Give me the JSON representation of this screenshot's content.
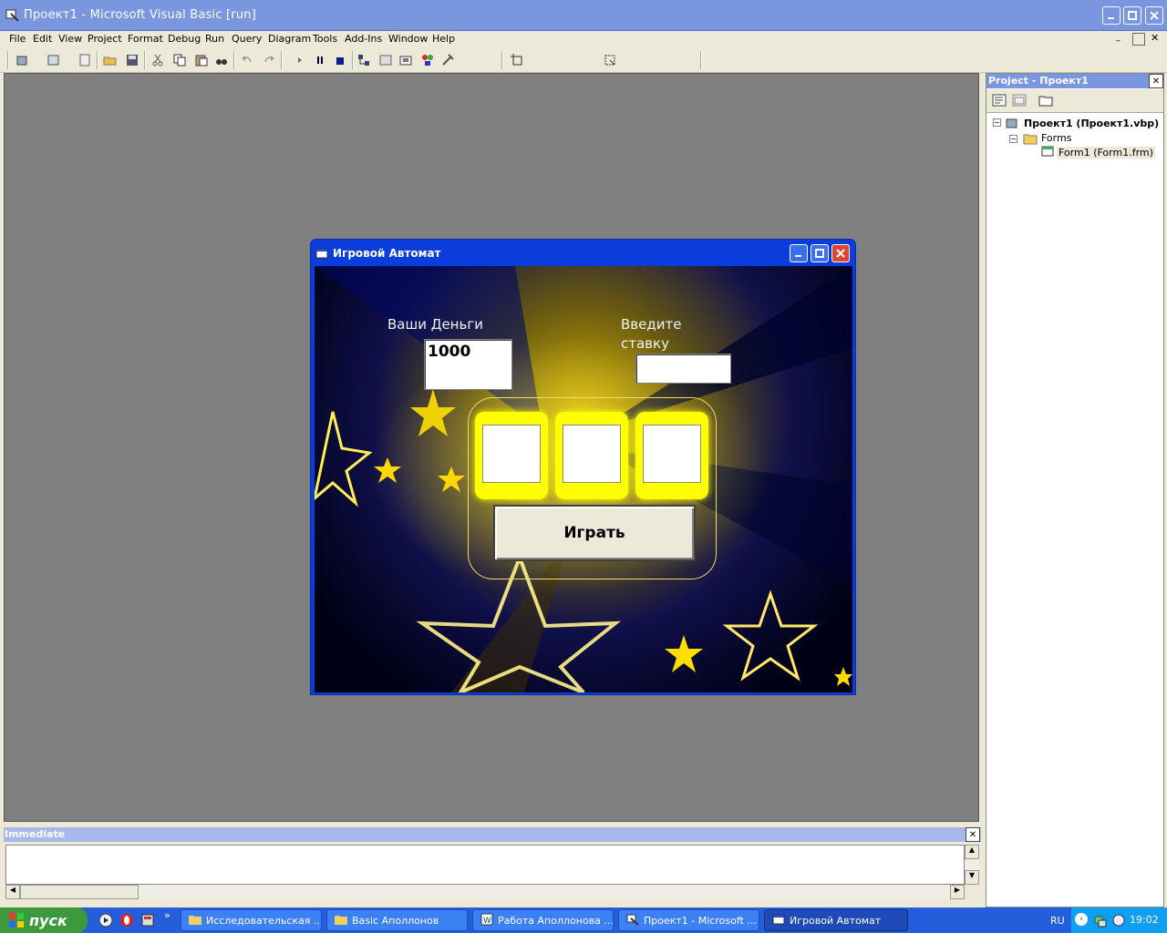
{
  "window": {
    "title": "Проект1 - Microsoft Visual Basic [run]"
  },
  "menu": [
    "File",
    "Edit",
    "View",
    "Project",
    "Format",
    "Debug",
    "Run",
    "Query",
    "Diagram",
    "Tools",
    "Add-Ins",
    "Window",
    "Help"
  ],
  "form": {
    "title": "Игровой Автомат",
    "money_label": "Ваши Деньги",
    "money_value": "1000",
    "bet_label_line1": "Введите",
    "bet_label_line2": "ставку",
    "bet_value": "",
    "play_button": "Играть"
  },
  "project": {
    "title": "Project - Проект1",
    "root": "Проект1 (Проект1.vbp)",
    "folder": "Forms",
    "item": "Form1 (Form1.frm)"
  },
  "immediate": {
    "title": "Immediate"
  },
  "taskbar": {
    "start": "пуск",
    "tasks": [
      "Исследовательская ...",
      "Basic Аполлонов",
      "Работа Аполлонова ...",
      "Проект1 - Microsoft ...",
      "Игровой Автомат"
    ],
    "lang": "RU",
    "time": "19:02"
  },
  "colors": {
    "titlebar": "#7a96df",
    "form_title": "#0a3ddb",
    "mdi": "#808080",
    "taskbar": "#245edb",
    "slot": "#ffff00"
  }
}
